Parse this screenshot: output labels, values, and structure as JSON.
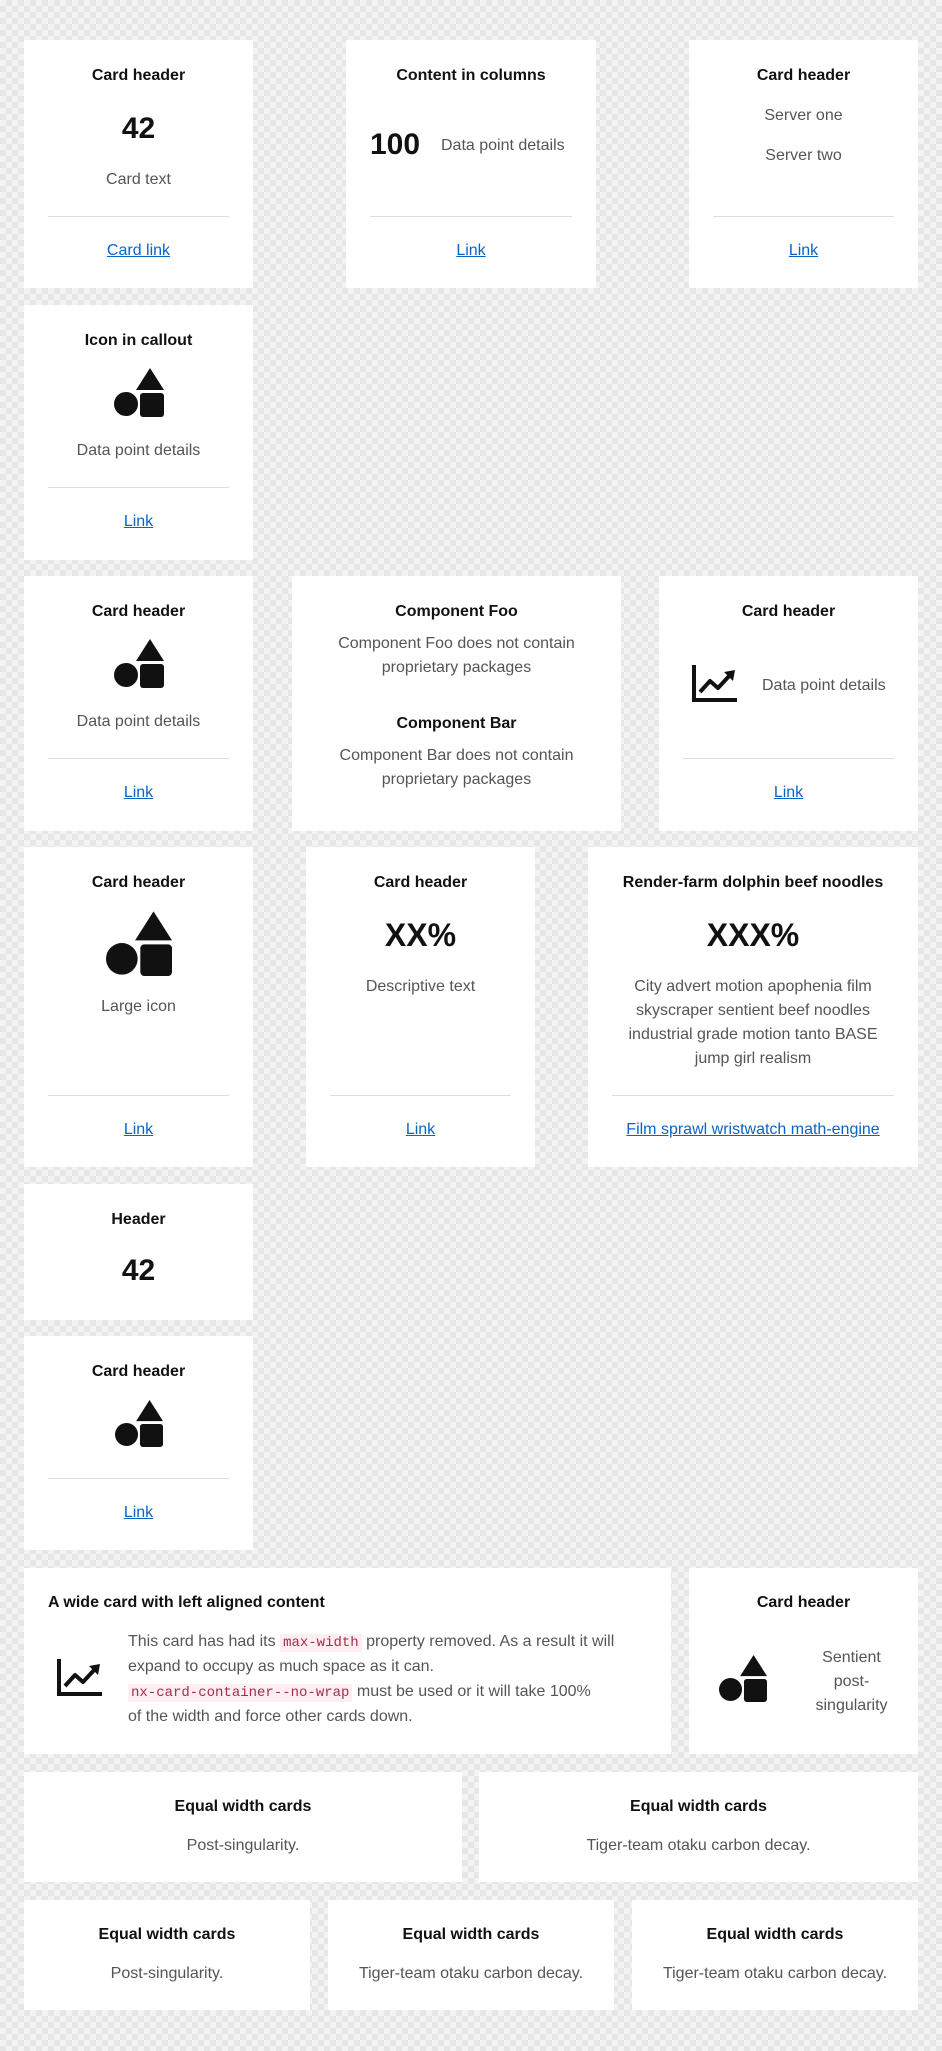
{
  "c1": {
    "header": "Card header",
    "value": "42",
    "text": "Card text",
    "link": "Card link"
  },
  "c2": {
    "header": "Content in columns",
    "value": "100",
    "text": "Data point details",
    "link": "Link"
  },
  "c3": {
    "header": "Card header",
    "server1": "Server one",
    "server2": "Server two",
    "link": "Link"
  },
  "c4": {
    "header": "Icon in callout",
    "icon": "shapes-icon",
    "text": "Data point details",
    "link": "Link"
  },
  "c5": {
    "header": "Card header",
    "icon": "shapes-icon",
    "text": "Data point details",
    "link": "Link"
  },
  "c6": {
    "foo_title": "Component Foo",
    "foo_line1": "Component Foo does not contain",
    "foo_line2": "proprietary packages",
    "bar_title": "Component Bar",
    "bar_line1": "Component Bar does not contain",
    "bar_line2": "proprietary packages"
  },
  "c7": {
    "header": "Card header",
    "icon": "trend-chart-icon",
    "text": "Data point details",
    "link": "Link"
  },
  "c8": {
    "header": "Card header",
    "icon": "shapes-icon",
    "text": "Large icon",
    "link": "Link"
  },
  "c9": {
    "header": "Card header",
    "value": "XX%",
    "text": "Descriptive text",
    "link": "Link"
  },
  "c10": {
    "header": "Render-farm dolphin beef noodles",
    "value": "XXX%",
    "lines": [
      "City advert motion apophenia film",
      "skyscraper sentient beef noodles",
      "industrial grade motion tanto BASE",
      "jump girl realism"
    ],
    "link": "Film sprawl wristwatch math-engine"
  },
  "c11": {
    "header": "Header",
    "value": "42"
  },
  "c12": {
    "header": "Card header",
    "icon": "shapes-icon",
    "link": "Link"
  },
  "c13": {
    "header": "A wide card with left aligned content",
    "icon": "trend-chart-icon",
    "t1": "This card has had its ",
    "code1": "max-width",
    "t2": " property removed. As a result it will",
    "t3": "expand to occupy as much space as it can.",
    "code2": "nx-card-container--no-wrap",
    "t4": " must be used or it will take 100%",
    "t5": "of the width and force other cards down."
  },
  "c14": {
    "header": "Card header",
    "icon": "shapes-icon",
    "line1": "Sentient",
    "line2": "post-",
    "line3": "singularity"
  },
  "eq2": [
    {
      "header": "Equal width cards",
      "text": "Post-singularity."
    },
    {
      "header": "Equal width cards",
      "text": "Tiger-team otaku carbon decay."
    }
  ],
  "eq3": [
    {
      "header": "Equal width cards",
      "text": "Post-singularity."
    },
    {
      "header": "Equal width cards",
      "text": "Tiger-team otaku carbon decay."
    },
    {
      "header": "Equal width cards",
      "text": "Tiger-team otaku carbon decay."
    }
  ]
}
